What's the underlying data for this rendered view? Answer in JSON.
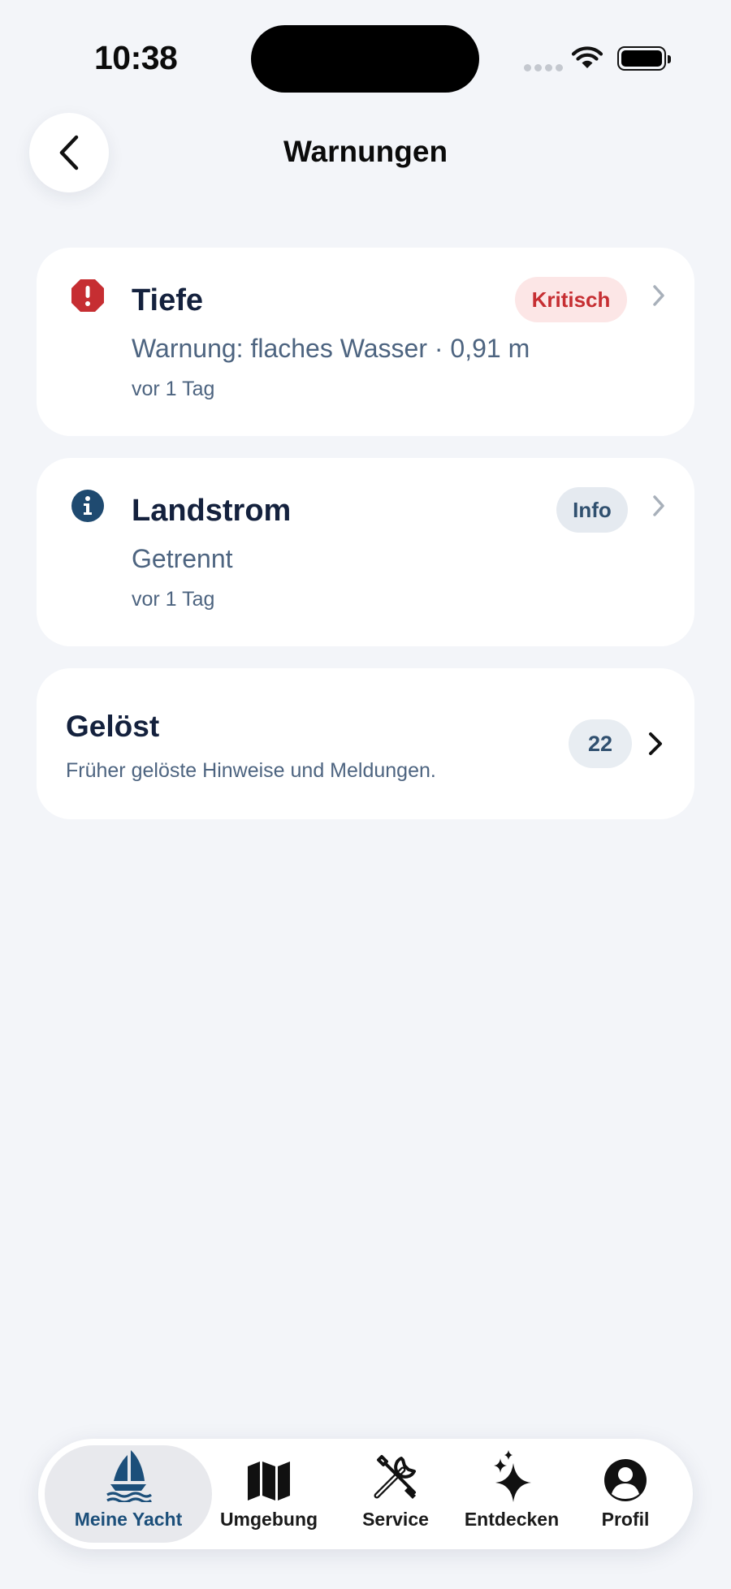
{
  "status_bar": {
    "time": "10:38"
  },
  "header": {
    "title": "Warnungen"
  },
  "alerts": [
    {
      "icon": "exclamation-octagon-icon",
      "title": "Tiefe",
      "badge": "Kritisch",
      "description": "Warnung: flaches Wasser · 0,91 m",
      "time": "vor 1 Tag",
      "accent_color": "#c62e32"
    },
    {
      "icon": "info-circle-icon",
      "title": "Landstrom",
      "badge": "Info",
      "description": "Getrennt",
      "time": "vor 1 Tag",
      "accent_color": "#1f4a70"
    }
  ],
  "resolved": {
    "title": "Gelöst",
    "subtitle": "Früher gelöste Hinweise und Meldungen.",
    "count": "22"
  },
  "tab_bar": {
    "active": "Meine Yacht",
    "items": [
      {
        "label": "Meine Yacht",
        "icon": "sailboat-icon"
      },
      {
        "label": "Umgebung",
        "icon": "map-icon"
      },
      {
        "label": "Service",
        "icon": "tools-icon"
      },
      {
        "label": "Entdecken",
        "icon": "sparkles-icon"
      },
      {
        "label": "Profil",
        "icon": "person-circle-icon"
      }
    ]
  },
  "colors": {
    "background": "#f3f5f9",
    "critical": "#c62e32",
    "info": "#1f4a70",
    "text_primary": "#14213d",
    "text_secondary": "#4d6480",
    "active_tab": "#1c4f7a"
  }
}
